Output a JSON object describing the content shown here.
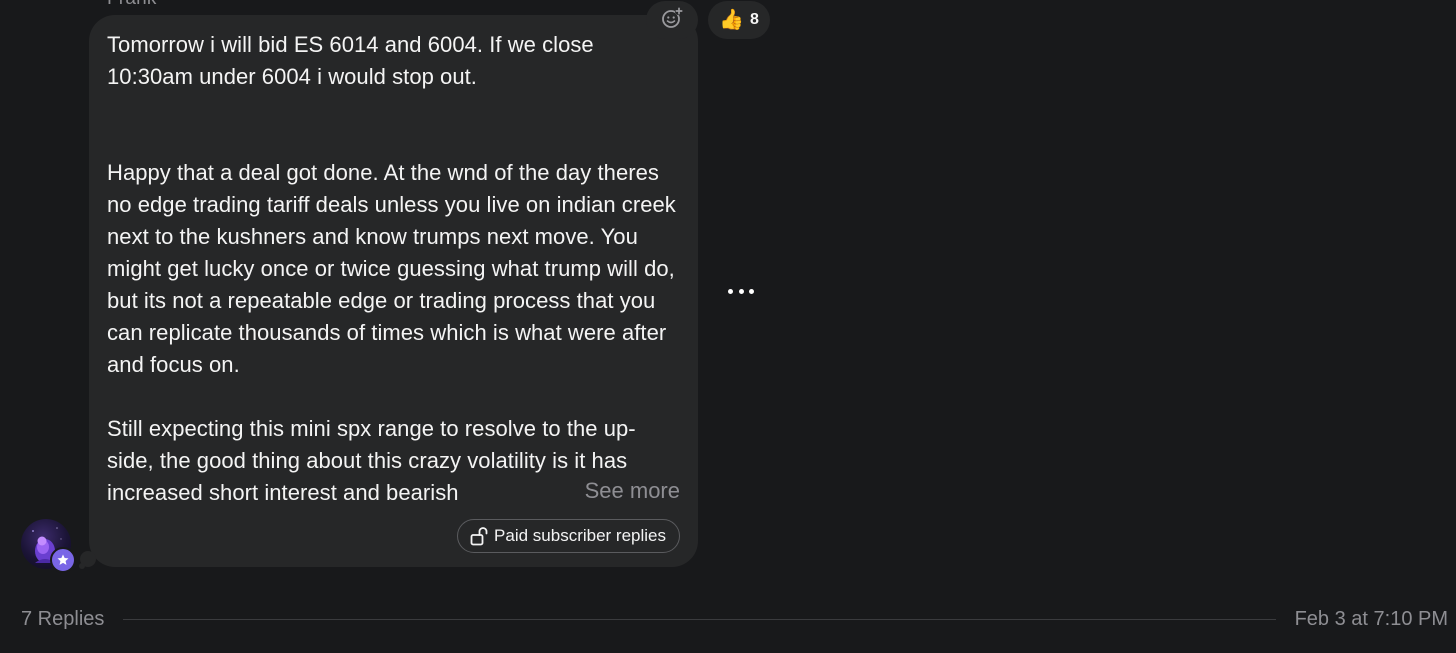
{
  "post": {
    "author": "Frank",
    "paragraphs": [
      "Tomorrow i will bid ES 6014 and 6004. If we close 10:30am under 6004 i would stop out.",
      "Happy that a deal got done. At the wnd of the day theres no edge trading tariff deals unless you live on indian creek next to the kushners and know trumps next move. You might get lucky once or twice guessing what trump will do, but its not a repeatable edge or trading process that you can replicate thousands of times which is what were after and focus on.",
      "Still expecting this mini spx range to resolve to the up-side, the good thing about this crazy volatility is it has increased short interest and bearish"
    ],
    "see_more_label": "See more",
    "paid_replies_label": "Paid subscriber replies"
  },
  "reactions": {
    "add_icon": "add-reaction-icon",
    "thumbs_up_emoji": "👍",
    "thumbs_up_count": "8"
  },
  "more_icon": "more-horizontal-icon",
  "footer": {
    "replies_label": "7 Replies",
    "timestamp": "Feb 3 at 7:10 PM"
  },
  "colors": {
    "background": "#18191b",
    "bubble": "#262728",
    "text": "#f4f4f4",
    "muted": "#8e8e93",
    "badge": "#7966e6"
  }
}
